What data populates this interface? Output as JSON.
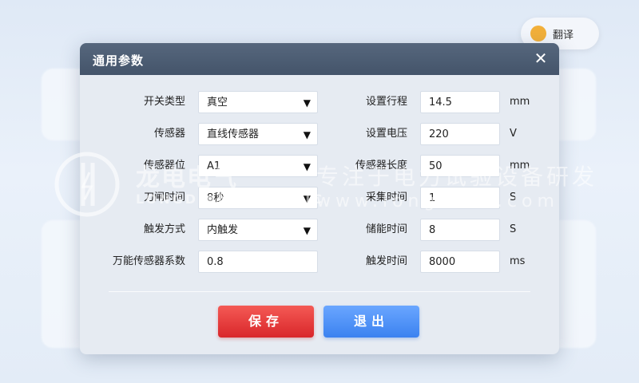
{
  "background": {
    "top_right_badge_text": "翻译"
  },
  "dialog": {
    "title": "通用参数",
    "close_symbol": "✕",
    "left_fields": [
      {
        "label": "开关类型",
        "value": "真空",
        "dropdown": true
      },
      {
        "label": "传感器",
        "value": "直线传感器",
        "dropdown": true
      },
      {
        "label": "传感器位",
        "value": "A1",
        "dropdown": true
      },
      {
        "label": "刀闸时间",
        "value": "8秒",
        "dropdown": true
      },
      {
        "label": "触发方式",
        "value": "内触发",
        "dropdown": true
      },
      {
        "label": "万能传感器系数",
        "value": "0.8",
        "dropdown": false
      }
    ],
    "right_fields": [
      {
        "label": "设置行程",
        "value": "14.5",
        "unit": "mm"
      },
      {
        "label": "设置电压",
        "value": "220",
        "unit": "V"
      },
      {
        "label": "传感器长度",
        "value": "50",
        "unit": "mm"
      },
      {
        "label": "采集时间",
        "value": "1",
        "unit": "S"
      },
      {
        "label": "储能时间",
        "value": "8",
        "unit": "S"
      },
      {
        "label": "触发时间",
        "value": "8000",
        "unit": "ms"
      }
    ],
    "save_label": "保存",
    "exit_label": "退出",
    "dropdown_arrow": "▼"
  },
  "watermark": {
    "brand_cn": "龙电电气",
    "brand_en": "LONGDIAN ELECTRIC",
    "slogan": "专注于电力试验设备研发",
    "url": "www.longdian.com"
  },
  "colors": {
    "titlebar": "#4d5d73",
    "save_button": "#e53935",
    "exit_button": "#4a8ef5"
  }
}
